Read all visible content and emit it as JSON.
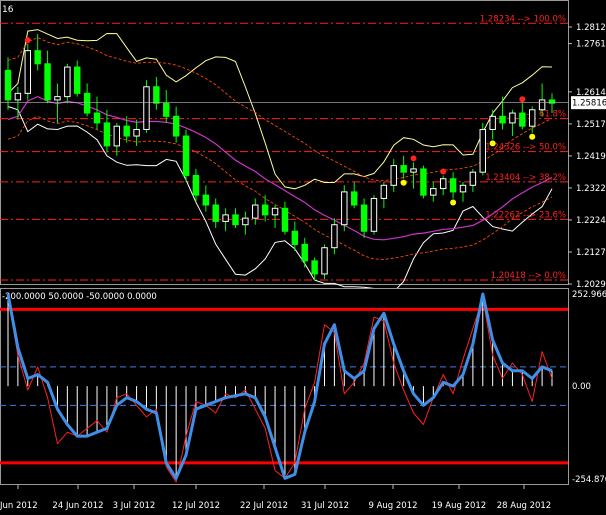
{
  "main_panel": {
    "symbol_fragment": "16",
    "price_ticks": [
      "1.28120",
      "1.27615",
      "1.26145",
      "1.25170",
      "1.24195",
      "1.23220",
      "1.22245",
      "1.21270",
      "1.20295"
    ],
    "current_price": "1.25816",
    "fib_levels": [
      {
        "label": "1.28234 --> 100.0%",
        "price": 1.28234
      },
      {
        "label": "--> 61.8%",
        "price": 1.25332
      },
      {
        "label": "1.24326 --> 50.0%",
        "price": 1.24326
      },
      {
        "label": "1.23404 --> 38.2%",
        "price": 1.23404
      },
      {
        "label": "1.22263 --> 23.6%",
        "price": 1.22263
      },
      {
        "label": "1.20418 --> 0.0%",
        "price": 1.20418
      }
    ]
  },
  "indicator_panel": {
    "header": "-200.0000 50.0000 -50.0000 0.0000",
    "axis_labels": [
      "252.966",
      "0.00",
      "-254.876"
    ],
    "max": 252.966,
    "min": -254.876,
    "levels": {
      "upper": 200,
      "upper_mid": 50,
      "lower_mid": -50,
      "lower": -200
    }
  },
  "date_axis": [
    "Jun 2012",
    "24 Jun 2012",
    "3 Jul 2012",
    "12 Jul 2012",
    "22 Jul 2012",
    "31 Jul 2012",
    "9 Aug 2012",
    "19 Aug 2012",
    "28 Aug 2012"
  ],
  "colors": {
    "background": "#000000",
    "candle_bull": "#ffffff",
    "candle_bear": "#00ff00",
    "bollinger_inner": "#ffffff",
    "bollinger_outer": "#ffff99",
    "envelope": "#ff4500",
    "ma_purple": "#cc33cc",
    "fib_line": "#ff2020",
    "cci_thick": "#3d8fe8",
    "cci_thin": "#ff2020",
    "histogram": "#ffffff",
    "level_band": "#ff0000",
    "mid_level": "#4a7ad8"
  },
  "chart_data": {
    "type": "candlestick",
    "price_range": [
      1.20295,
      1.2812
    ],
    "ohlc": [
      [
        1.268,
        1.272,
        1.256,
        1.259
      ],
      [
        1.259,
        1.263,
        1.253,
        1.261
      ],
      [
        1.261,
        1.276,
        1.259,
        1.274
      ],
      [
        1.274,
        1.279,
        1.268,
        1.27
      ],
      [
        1.27,
        1.274,
        1.258,
        1.259
      ],
      [
        1.259,
        1.264,
        1.252,
        1.26
      ],
      [
        1.26,
        1.27,
        1.258,
        1.269
      ],
      [
        1.269,
        1.271,
        1.26,
        1.261
      ],
      [
        1.261,
        1.264,
        1.254,
        1.255
      ],
      [
        1.255,
        1.26,
        1.25,
        1.252
      ],
      [
        1.252,
        1.256,
        1.243,
        1.245
      ],
      [
        1.245,
        1.252,
        1.242,
        1.251
      ],
      [
        1.251,
        1.254,
        1.246,
        1.248
      ],
      [
        1.248,
        1.253,
        1.245,
        1.25
      ],
      [
        1.25,
        1.265,
        1.249,
        1.263
      ],
      [
        1.263,
        1.266,
        1.256,
        1.258
      ],
      [
        1.258,
        1.262,
        1.252,
        1.254
      ],
      [
        1.254,
        1.257,
        1.246,
        1.248
      ],
      [
        1.248,
        1.25,
        1.234,
        1.236
      ],
      [
        1.236,
        1.238,
        1.228,
        1.23
      ],
      [
        1.23,
        1.233,
        1.225,
        1.227
      ],
      [
        1.227,
        1.229,
        1.22,
        1.222
      ],
      [
        1.222,
        1.226,
        1.219,
        1.224
      ],
      [
        1.224,
        1.226,
        1.22,
        1.221
      ],
      [
        1.221,
        1.225,
        1.218,
        1.223
      ],
      [
        1.223,
        1.229,
        1.221,
        1.227
      ],
      [
        1.227,
        1.23,
        1.222,
        1.224
      ],
      [
        1.224,
        1.227,
        1.22,
        1.226
      ],
      [
        1.226,
        1.228,
        1.218,
        1.219
      ],
      [
        1.219,
        1.222,
        1.213,
        1.215
      ],
      [
        1.215,
        1.217,
        1.208,
        1.21
      ],
      [
        1.21,
        1.211,
        1.204,
        1.206
      ],
      [
        1.206,
        1.215,
        1.2045,
        1.214
      ],
      [
        1.214,
        1.223,
        1.212,
        1.221
      ],
      [
        1.221,
        1.233,
        1.219,
        1.231
      ],
      [
        1.231,
        1.234,
        1.226,
        1.227
      ],
      [
        1.227,
        1.229,
        1.217,
        1.219
      ],
      [
        1.219,
        1.23,
        1.218,
        1.229
      ],
      [
        1.229,
        1.234,
        1.226,
        1.233
      ],
      [
        1.233,
        1.241,
        1.231,
        1.239
      ],
      [
        1.239,
        1.242,
        1.235,
        1.237
      ],
      [
        1.237,
        1.24,
        1.232,
        1.238
      ],
      [
        1.238,
        1.239,
        1.229,
        1.23
      ],
      [
        1.23,
        1.234,
        1.228,
        1.232
      ],
      [
        1.232,
        1.236,
        1.23,
        1.235
      ],
      [
        1.235,
        1.237,
        1.229,
        1.231
      ],
      [
        1.231,
        1.234,
        1.228,
        1.233
      ],
      [
        1.233,
        1.238,
        1.231,
        1.237
      ],
      [
        1.237,
        1.252,
        1.236,
        1.25
      ],
      [
        1.25,
        1.256,
        1.247,
        1.254
      ],
      [
        1.254,
        1.26,
        1.25,
        1.252
      ],
      [
        1.252,
        1.256,
        1.248,
        1.255
      ],
      [
        1.255,
        1.258,
        1.25,
        1.251
      ],
      [
        1.251,
        1.257,
        1.249,
        1.256
      ],
      [
        1.256,
        1.264,
        1.254,
        1.259
      ],
      [
        1.259,
        1.261,
        1.255,
        1.258
      ]
    ],
    "cci_thick": [
      240,
      100,
      20,
      30,
      10,
      -60,
      -100,
      -130,
      -130,
      -120,
      -110,
      -50,
      -30,
      -40,
      -60,
      -70,
      -200,
      -240,
      -180,
      -60,
      -50,
      -40,
      -30,
      -25,
      -20,
      -30,
      -80,
      -160,
      -240,
      -230,
      -120,
      -40,
      110,
      160,
      40,
      20,
      40,
      150,
      190,
      110,
      40,
      -20,
      -50,
      -30,
      10,
      0,
      30,
      110,
      240,
      120,
      60,
      40,
      40,
      20,
      50,
      40
    ],
    "cci_thin": [
      230,
      80,
      -10,
      50,
      -30,
      -150,
      -120,
      -130,
      -110,
      -90,
      -120,
      -30,
      -20,
      -50,
      -80,
      -60,
      -210,
      -250,
      -130,
      -40,
      -50,
      -70,
      -20,
      -30,
      -10,
      -60,
      -110,
      -220,
      -240,
      -200,
      -60,
      10,
      160,
      140,
      -20,
      10,
      60,
      180,
      170,
      60,
      -10,
      -70,
      -100,
      -30,
      30,
      -20,
      70,
      150,
      230,
      80,
      20,
      60,
      30,
      -40,
      90,
      20
    ]
  }
}
